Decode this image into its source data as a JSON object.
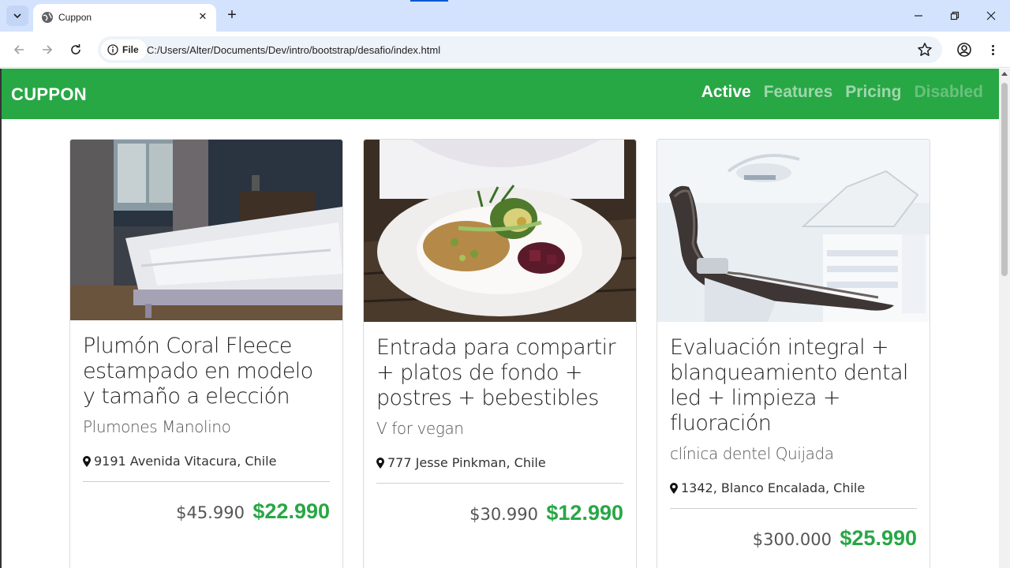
{
  "browser": {
    "tab_title": "Cuppon",
    "site_chip": "File",
    "url": "C:/Users/Alter/Documents/Dev/intro/bootstrap/desafio/index.html"
  },
  "navbar": {
    "brand": "CUPPON",
    "links": [
      {
        "label": "Active",
        "state": "active"
      },
      {
        "label": "Features",
        "state": "normal"
      },
      {
        "label": "Pricing",
        "state": "normal"
      },
      {
        "label": "Disabled",
        "state": "disabled"
      }
    ]
  },
  "cards": [
    {
      "title": "Plumón Coral Fleece estampado en modelo y tamaño a elección",
      "subtitle": "Plumones Manolino",
      "location": "9191 Avenida Vitacura, Chile",
      "old_price": "$45.990",
      "new_price": "$22.990",
      "image": "bedroom-photo"
    },
    {
      "title": "Entrada para compartir + platos de fondo + postres + bebestibles",
      "subtitle": "V for vegan",
      "location": "777 Jesse Pinkman, Chile",
      "old_price": "$30.990",
      "new_price": "$12.990",
      "image": "vegan-plate-photo"
    },
    {
      "title": "Evaluación integral + blanqueamiento dental led + limpieza + fluoración",
      "subtitle": "clínica dentel Quijada",
      "location": "1342, Blanco Encalada, Chile",
      "old_price": "$300.000",
      "new_price": "$25.990",
      "image": "dental-chair-photo"
    }
  ],
  "colors": {
    "brand_green": "#28a745",
    "chrome_blue": "#d3e3fd"
  }
}
